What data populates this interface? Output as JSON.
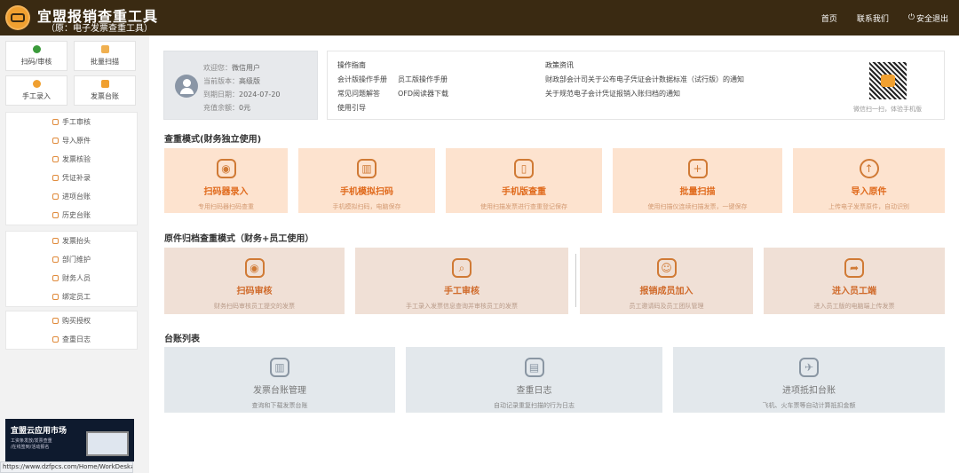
{
  "header": {
    "title": "宜盟报销查重工具",
    "subtitle": "（原：电子发票查重工具）",
    "nav": [
      "首页",
      "联系我们",
      "安全退出"
    ]
  },
  "sidebar": {
    "tiles": [
      "扫码/审核",
      "批量扫描",
      "手工录入",
      "发票台账"
    ],
    "group1": [
      "手工审核",
      "导入原件",
      "发票核验",
      "凭证补录",
      "进项台账",
      "历史台账"
    ],
    "group2": [
      "发票抬头",
      "部门维护",
      "财务人员",
      "绑定员工"
    ],
    "group3": [
      "购买授权",
      "查重日志"
    ],
    "promo": {
      "title": "宜盟云应用市场",
      "sub1": "工资条发放/发票查重",
      "sub2": "/在线签到/活动报名"
    },
    "status_url": "https://www.dzfpcs.com/Home/WorkDesk#"
  },
  "user": {
    "welcome": "欢迎您：",
    "name": "微信用户",
    "version_label": "当前版本：",
    "version": "高级版",
    "expire_label": "到期日期：",
    "expire": "2024-07-20",
    "balance_label": "充值余额：",
    "balance": "0元"
  },
  "guide": {
    "ops_title": "操作指南",
    "ops": [
      "会计版操作手册",
      "员工版操作手册",
      "常见问题解答",
      "OFD阅读器下载",
      "使用引导"
    ],
    "policy_title": "政策资讯",
    "policy": [
      "财政部会计司关于公布电子凭证会计数据标准（试行版）的通知",
      "关于规范电子会计凭证报销入账归档的通知"
    ],
    "qr_caption": "微信扫一扫，体验手机版"
  },
  "section1": {
    "title": "查重模式(财务独立使用)",
    "cards": [
      {
        "title": "扫码器录入",
        "sub": "专用扫码器扫码查重"
      },
      {
        "title": "手机模拟扫码",
        "sub": "手机模拟扫码，电脑保存"
      },
      {
        "title": "手机版查重",
        "sub": "使用扫描发票进行查重登记保存"
      },
      {
        "title": "批量扫描",
        "sub": "使用扫描仪连续扫描发票，一键保存"
      },
      {
        "title": "导入原件",
        "sub": "上传电子发票原件，自动识别"
      }
    ]
  },
  "section2": {
    "title": "原件归档查重模式（财务+员工使用）",
    "cards": [
      {
        "title": "扫码审核",
        "sub": "财务扫码审核员工提交的发票"
      },
      {
        "title": "手工审核",
        "sub": "手工录入发票信息查询并审核员工的发票"
      },
      {
        "title": "报销成员加入",
        "sub": "员工邀请码及员工团队管理"
      },
      {
        "title": "进入员工端",
        "sub": "进入员工版的电脑端上传发票"
      }
    ]
  },
  "section3": {
    "title": "台账列表",
    "cards": [
      {
        "title": "发票台账管理",
        "sub": "查询和下载发票台账"
      },
      {
        "title": "查重日志",
        "sub": "自动记录重复扫描的行为日志"
      },
      {
        "title": "进项抵扣台账",
        "sub": "飞机、火车票等自动计算抵扣金额"
      }
    ]
  }
}
